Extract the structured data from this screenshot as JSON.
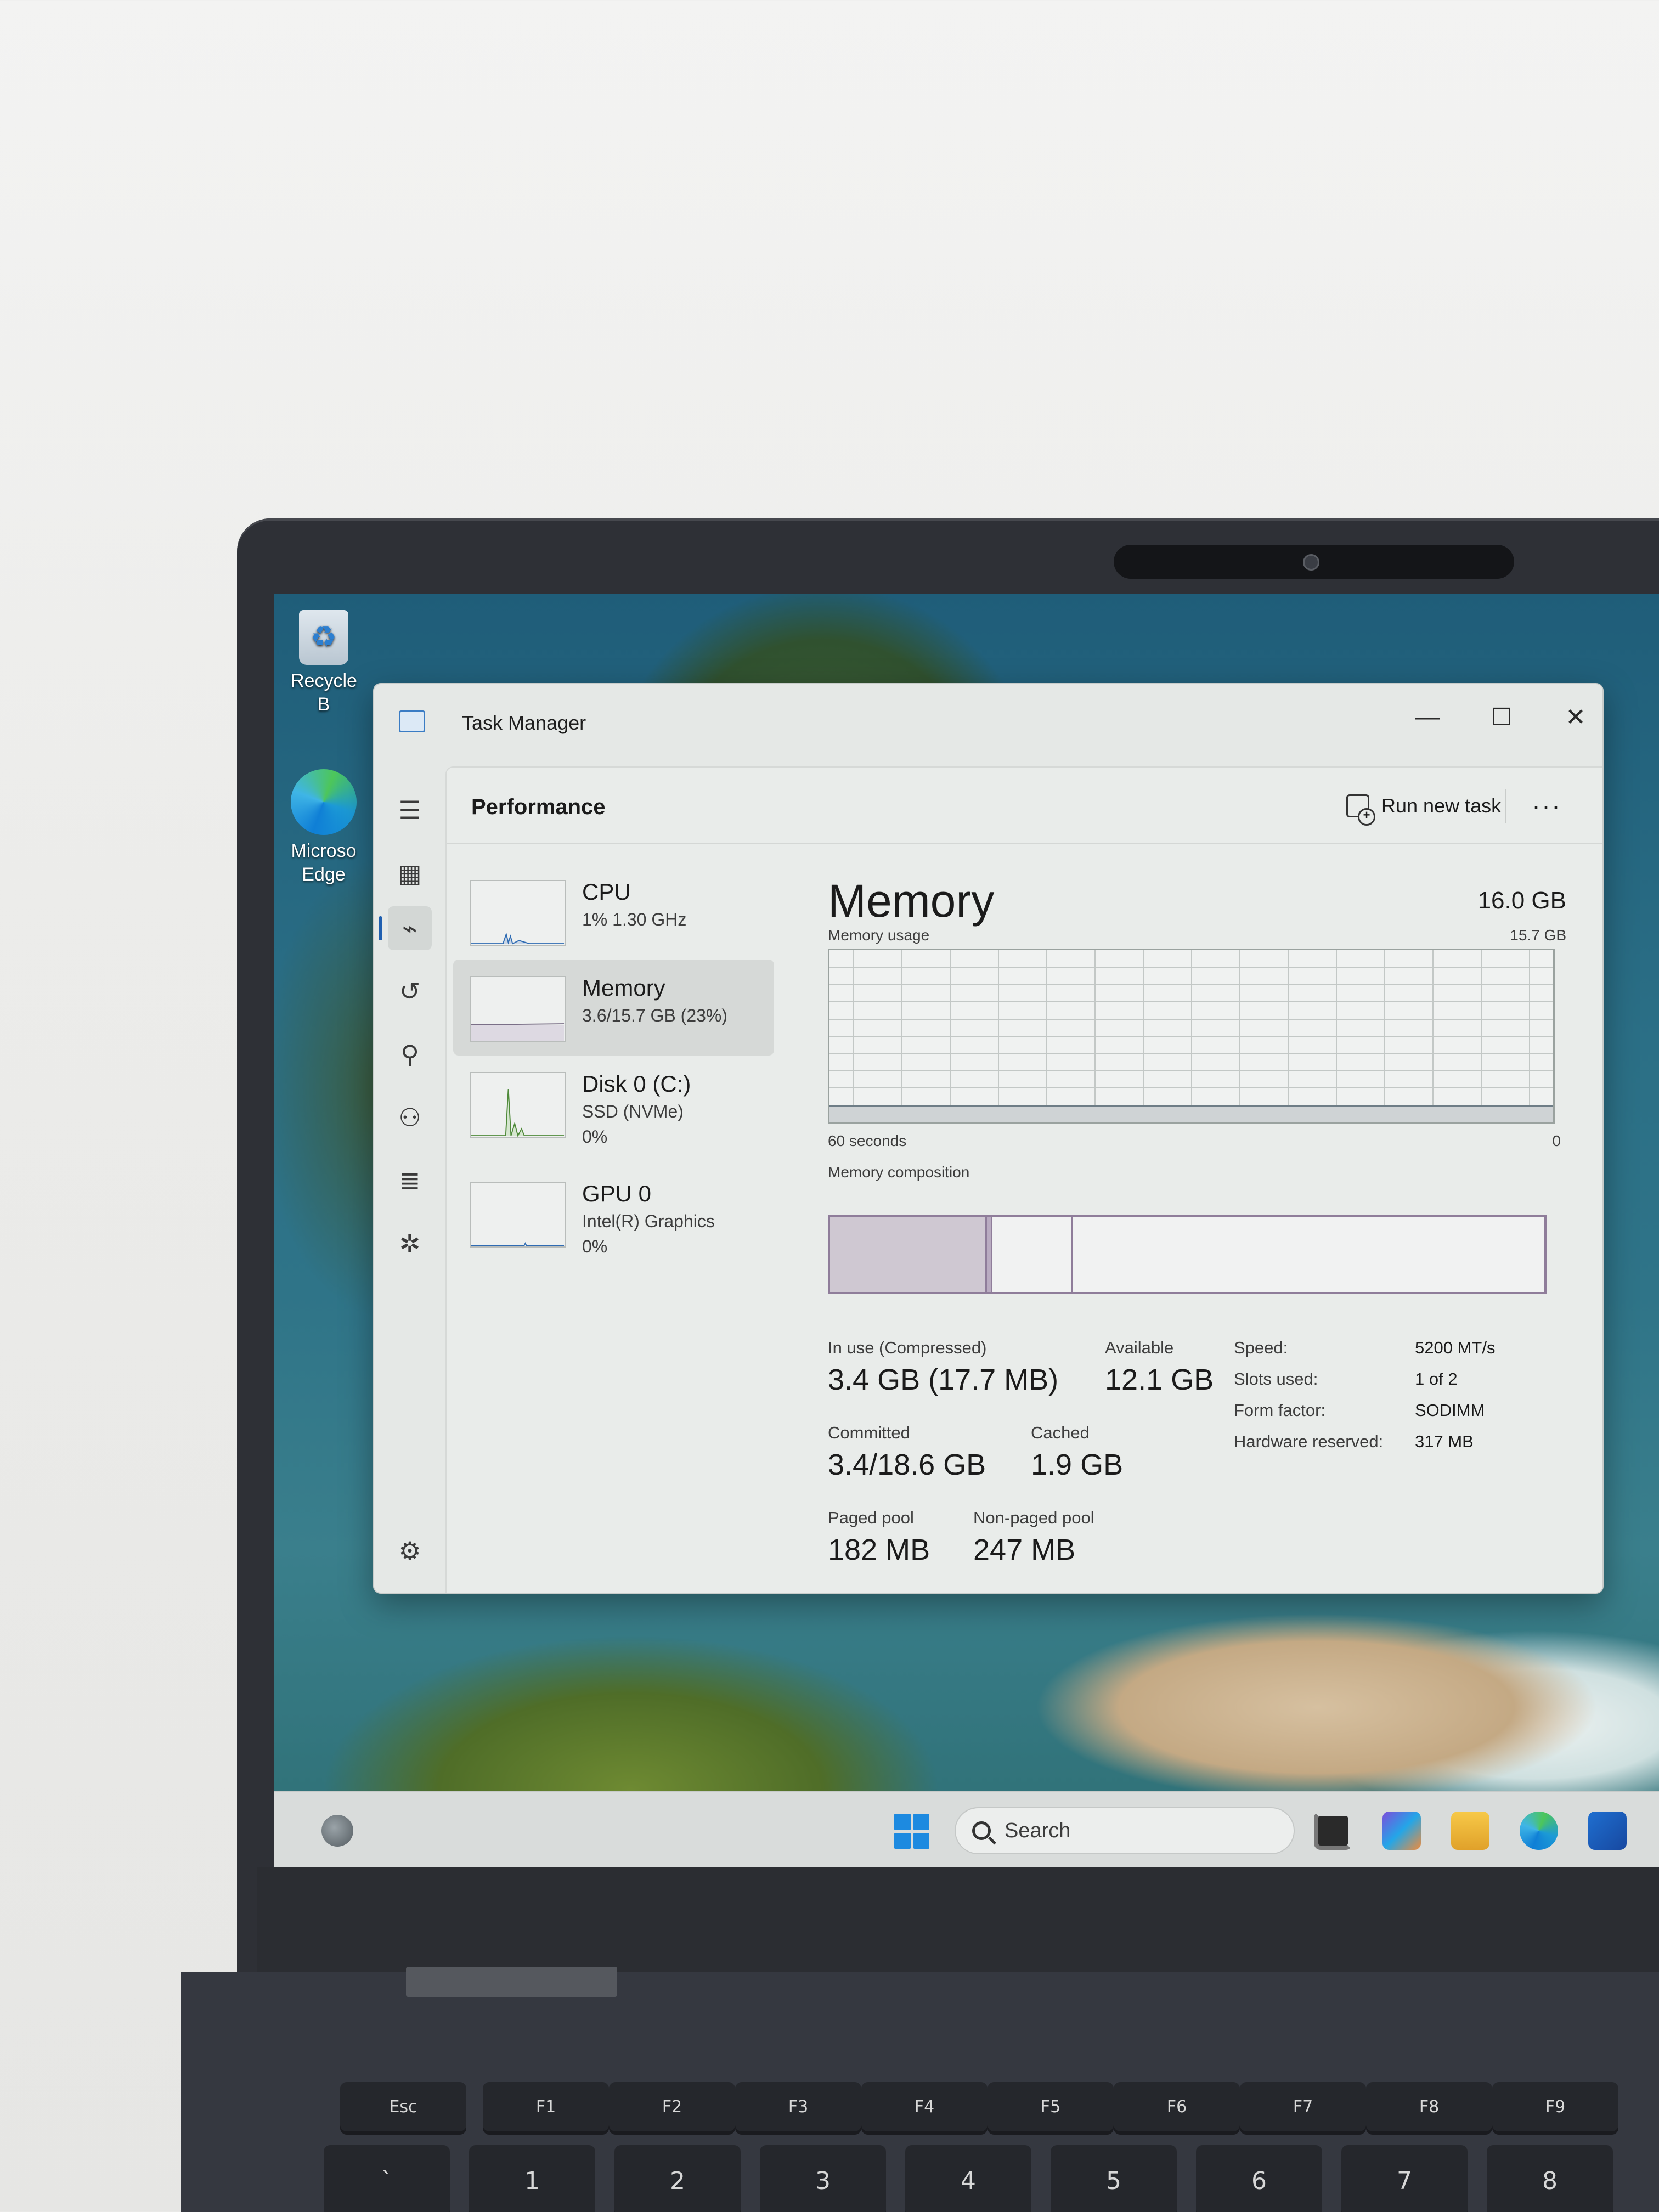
{
  "desktop": {
    "icons": [
      {
        "label": "Recycle B",
        "icon": "recycle-bin-icon"
      },
      {
        "label": "Microso\nEdge",
        "icon": "edge-icon"
      }
    ]
  },
  "window": {
    "title": "Task Manager",
    "controls": {
      "minimize": "—",
      "maximize": "☐",
      "close": "✕"
    }
  },
  "nav": {
    "items": [
      "hamburger-icon",
      "processes-icon",
      "performance-icon",
      "app-history-icon",
      "startup-apps-icon",
      "users-icon",
      "details-icon",
      "services-icon",
      "settings-icon"
    ],
    "active": "performance-icon"
  },
  "header": {
    "title": "Performance",
    "run_new_task": "Run new task",
    "more": "···"
  },
  "resources": [
    {
      "name": "CPU",
      "line1": "1%  1.30 GHz",
      "line2": ""
    },
    {
      "name": "Memory",
      "line1": "3.6/15.7 GB (23%)",
      "line2": ""
    },
    {
      "name": "Disk 0 (C:)",
      "line1": "SSD (NVMe)",
      "line2": "0%"
    },
    {
      "name": "GPU 0",
      "line1": "Intel(R) Graphics",
      "line2": "0%"
    }
  ],
  "detail": {
    "title": "Memory",
    "total": "16.0 GB",
    "usage_label": "Memory usage",
    "usage_max": "15.7 GB",
    "time_left": "60 seconds",
    "time_right": "0",
    "usage_fraction": 0.23,
    "composition_label": "Memory composition",
    "composition": {
      "in_use_fraction": 0.22,
      "standby_fraction": 0.34
    },
    "stats": {
      "in_use_label": "In use (Compressed)",
      "in_use_value": "3.4 GB (17.7 MB)",
      "available_label": "Available",
      "available_value": "12.1 GB",
      "committed_label": "Committed",
      "committed_value": "3.4/18.6 GB",
      "cached_label": "Cached",
      "cached_value": "1.9 GB",
      "paged_label": "Paged pool",
      "paged_value": "182 MB",
      "nonpaged_label": "Non-paged pool",
      "nonpaged_value": "247 MB"
    },
    "specs": {
      "speed_label": "Speed:",
      "speed_value": "5200 MT/s",
      "slots_label": "Slots used:",
      "slots_value": "1 of 2",
      "form_label": "Form factor:",
      "form_value": "SODIMM",
      "reserved_label": "Hardware reserved:",
      "reserved_value": "317 MB"
    }
  },
  "taskbar": {
    "search_placeholder": "Search",
    "apps": [
      "widgets-icon",
      "start-icon",
      "task-view-icon",
      "copilot-m365-icon",
      "file-explorer-icon",
      "edge-icon",
      "store-icon"
    ]
  },
  "keyboard": {
    "fn_row": [
      "Esc",
      "F1",
      "F2",
      "F3",
      "F4",
      "F5",
      "F6",
      "F7",
      "F8",
      "F9"
    ],
    "number_row": [
      [
        "~",
        "`"
      ],
      [
        "!",
        "1"
      ],
      [
        "@",
        "2"
      ],
      [
        "#",
        "3"
      ],
      [
        "$",
        "4"
      ],
      [
        "%",
        "5"
      ],
      [
        "^",
        "6"
      ],
      [
        "&",
        "7"
      ],
      [
        "*",
        "8"
      ]
    ]
  },
  "colors": {
    "accent": "#1f5fb0",
    "memory_graph_line": "#6e7d86",
    "composition_border": "#8f7d9a"
  }
}
